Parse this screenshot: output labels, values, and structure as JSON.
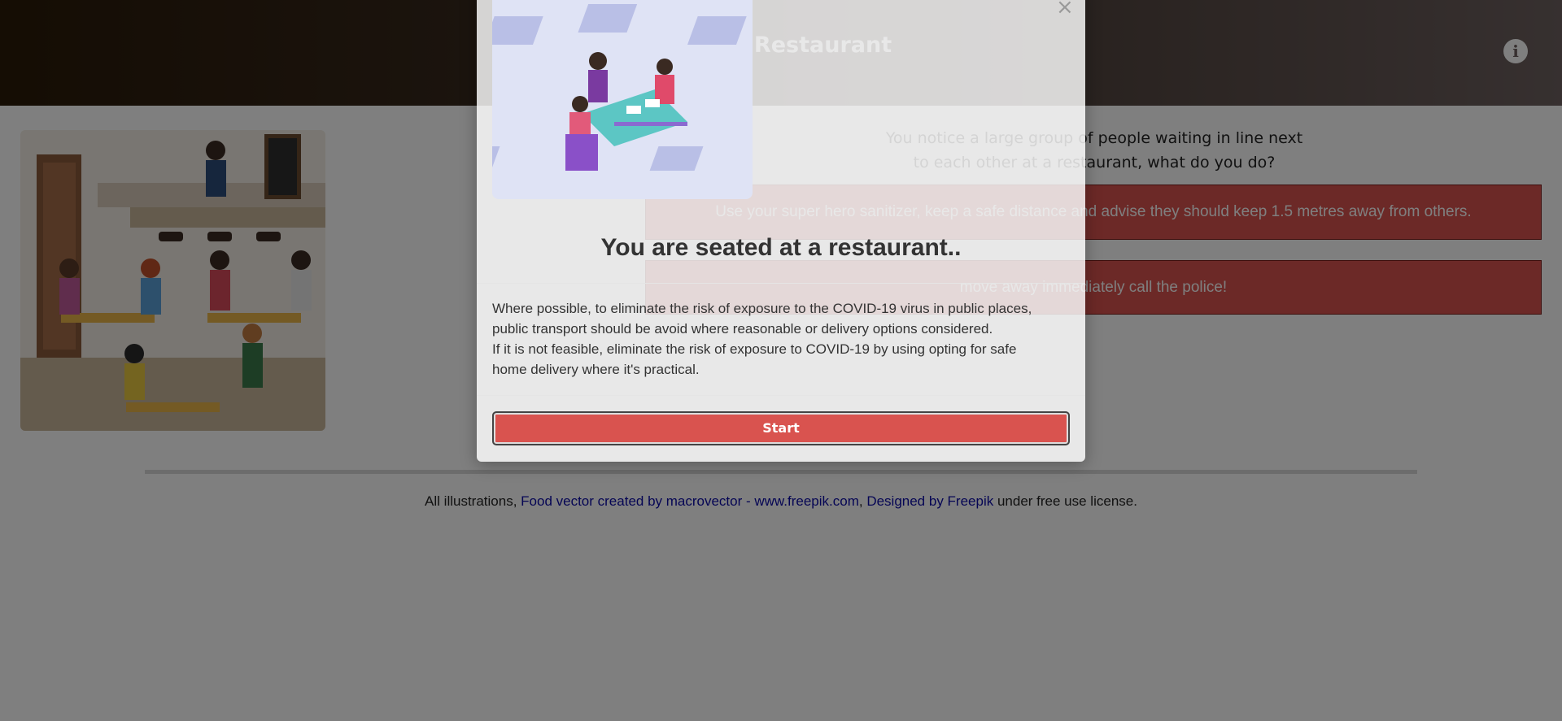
{
  "header": {
    "title": "At the Restaurant",
    "info_icon": "info-circle-icon"
  },
  "question": {
    "line1": "You notice a large group of people waiting in line next",
    "line2": "to each other at a restaurant, what do you do?"
  },
  "answers": [
    {
      "label": "Use your super hero sanitizer, keep a safe distance and advise they should keep 1.5 metres away from others."
    },
    {
      "label": "move away immediately call the police!"
    }
  ],
  "footer": {
    "prefix": "All illustrations, ",
    "link1": "Food vector created by macrovector - www.freepik.com",
    "sep": ", ",
    "link2": "Designed by Freepik",
    "suffix": " under free use license."
  },
  "modal": {
    "close": "×",
    "title": "You are seated at a restaurant..",
    "body_line1": "Where possible, to eliminate the risk of exposure to the COVID-19 virus in public places,",
    "body_line2": "public transport should be avoid where reasonable or delivery options considered.",
    "body_line3": "If it is not feasible, eliminate the risk of exposure to COVID-19 by using opting for safe",
    "body_line4": "home delivery where it's practical.",
    "start_label": "Start"
  },
  "colors": {
    "accent": "#d9534f",
    "header_dark": "#2a1a08"
  }
}
